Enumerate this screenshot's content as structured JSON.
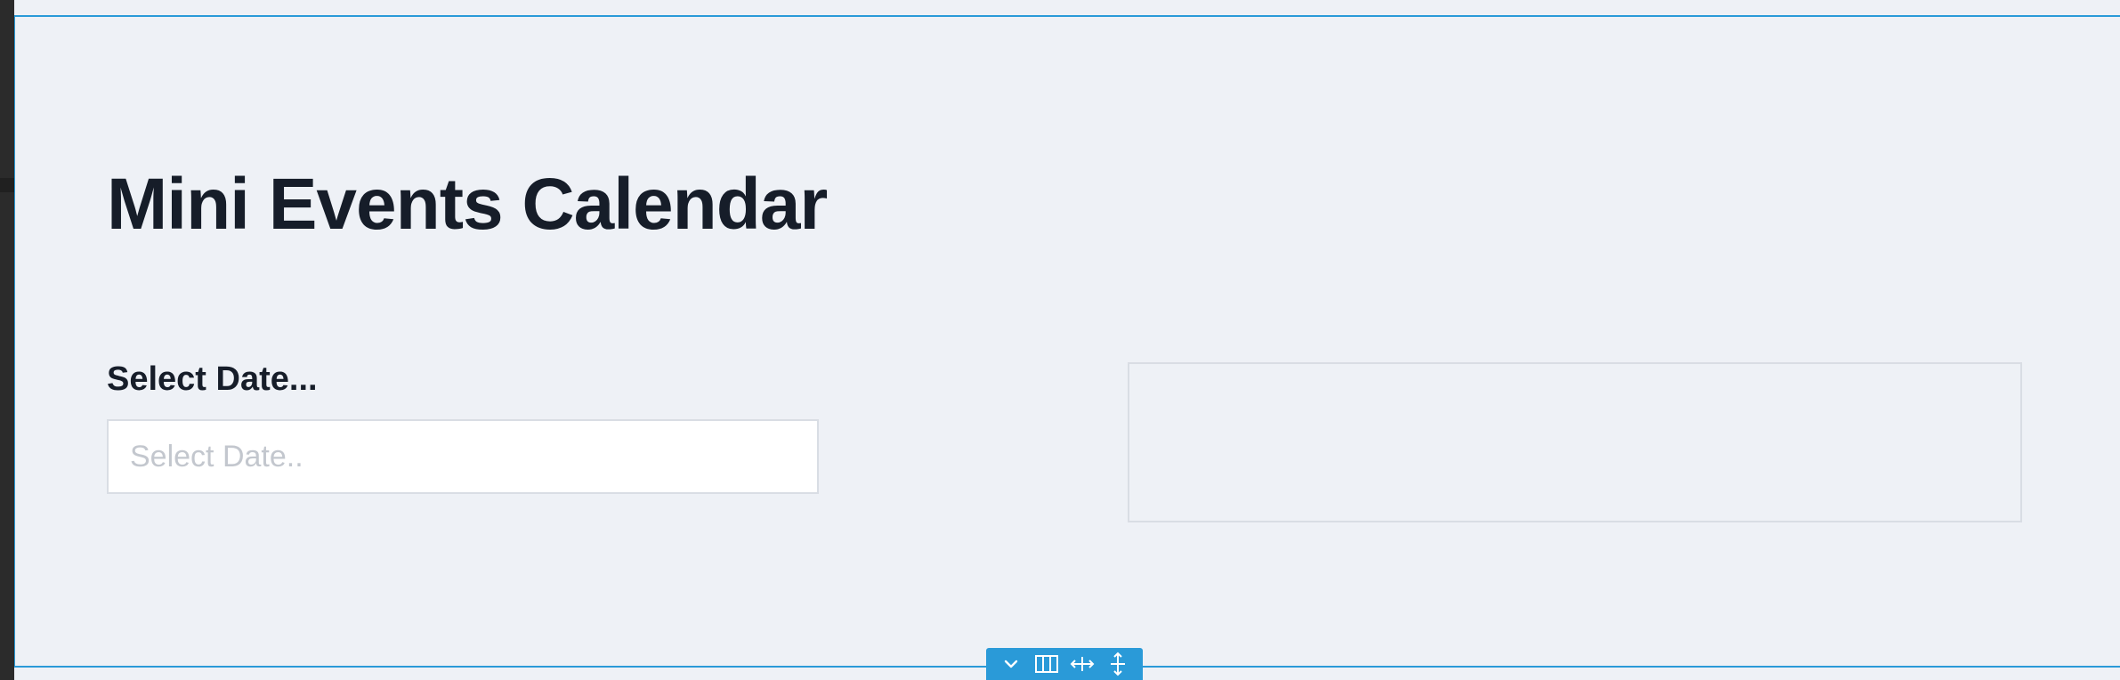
{
  "page": {
    "title": "Mini Events Calendar"
  },
  "date_picker": {
    "label": "Select Date...",
    "value": "",
    "placeholder": "Select Date.."
  },
  "section_toolbar": {
    "items": [
      {
        "icon": "chevron-down-icon"
      },
      {
        "icon": "columns-icon"
      },
      {
        "icon": "resize-horizontal-icon"
      },
      {
        "icon": "resize-vertical-icon"
      }
    ]
  },
  "colors": {
    "canvas_background": "#eef1f6",
    "heading_text": "#161d29",
    "editor_accent": "#2a9ad8",
    "input_border": "#d9dde4",
    "placeholder_text": "#c3c7ce"
  }
}
